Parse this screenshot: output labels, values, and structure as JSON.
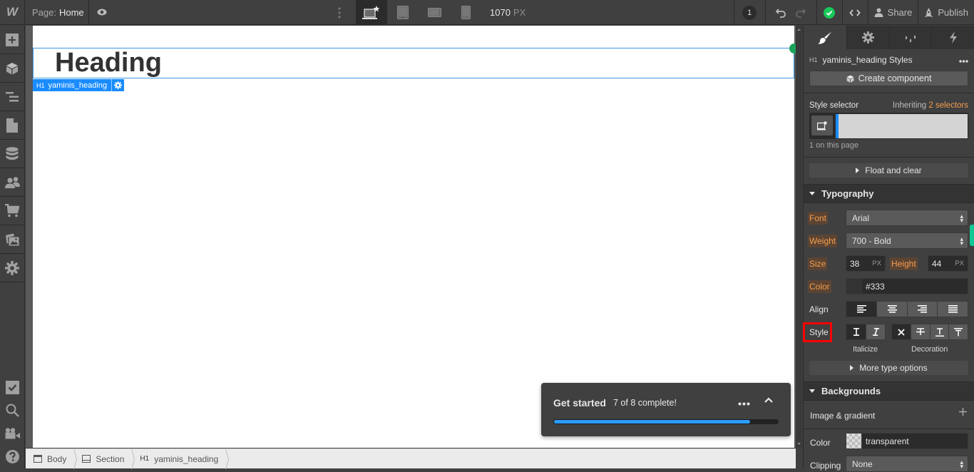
{
  "topbar": {
    "logo": "W",
    "page_prefix": "Page:",
    "page_name": "Home",
    "width_value": "1070",
    "width_unit": "PX",
    "notification_count": "1",
    "share_label": "Share",
    "publish_label": "Publish"
  },
  "leftbar": {
    "top_icons": [
      "add-panel",
      "components",
      "navigator",
      "pages",
      "cms",
      "users",
      "ecommerce",
      "assets",
      "settings"
    ],
    "bottom_icons": [
      "audit",
      "search",
      "video-tutorials",
      "help"
    ]
  },
  "canvas": {
    "heading_text": "Heading",
    "element_tag": "H1",
    "element_class": "yaminis_heading"
  },
  "get_started": {
    "title": "Get started",
    "status": "7 of 8 complete!",
    "completed": 7,
    "total": 8
  },
  "breadcrumb": [
    {
      "icon": "body",
      "label": "Body"
    },
    {
      "icon": "section",
      "label": "Section"
    },
    {
      "icon": "H1",
      "label": "yaminis_heading"
    }
  ],
  "panel": {
    "tabs": [
      "style",
      "settings",
      "style-manager",
      "interactions"
    ],
    "element_tag": "H1",
    "styles_title": "yaminis_heading Styles",
    "create_component": "Create component",
    "style_selector_label": "Style selector",
    "inheriting_prefix": "Inheriting",
    "inheriting_link": "2 selectors",
    "on_page": "1 on this page",
    "float_and_clear": "Float and clear",
    "typography": {
      "title": "Typography",
      "font_label": "Font",
      "font_value": "Arial",
      "weight_label": "Weight",
      "weight_value": "700 - Bold",
      "size_label": "Size",
      "size_value": "38",
      "size_unit": "PX",
      "height_label": "Height",
      "height_value": "44",
      "height_unit": "PX",
      "color_label": "Color",
      "color_value": "#333",
      "align_label": "Align",
      "align_options": [
        "left",
        "center",
        "right",
        "justify"
      ],
      "align_selected": "left",
      "style_label": "Style",
      "italicize_label": "Italicize",
      "decoration_label": "Decoration",
      "more_type_options": "More type options"
    },
    "backgrounds": {
      "title": "Backgrounds",
      "image_gradient": "Image & gradient",
      "color_label": "Color",
      "color_value": "transparent",
      "clipping_label": "Clipping",
      "clipping_value": "None"
    }
  },
  "colors": {
    "accent_blue": "#1a8cff",
    "selector_orange": "#f49d4c",
    "success_green": "#19a35b",
    "highlight_red": "#ff0000",
    "heading_color": "#333333"
  }
}
